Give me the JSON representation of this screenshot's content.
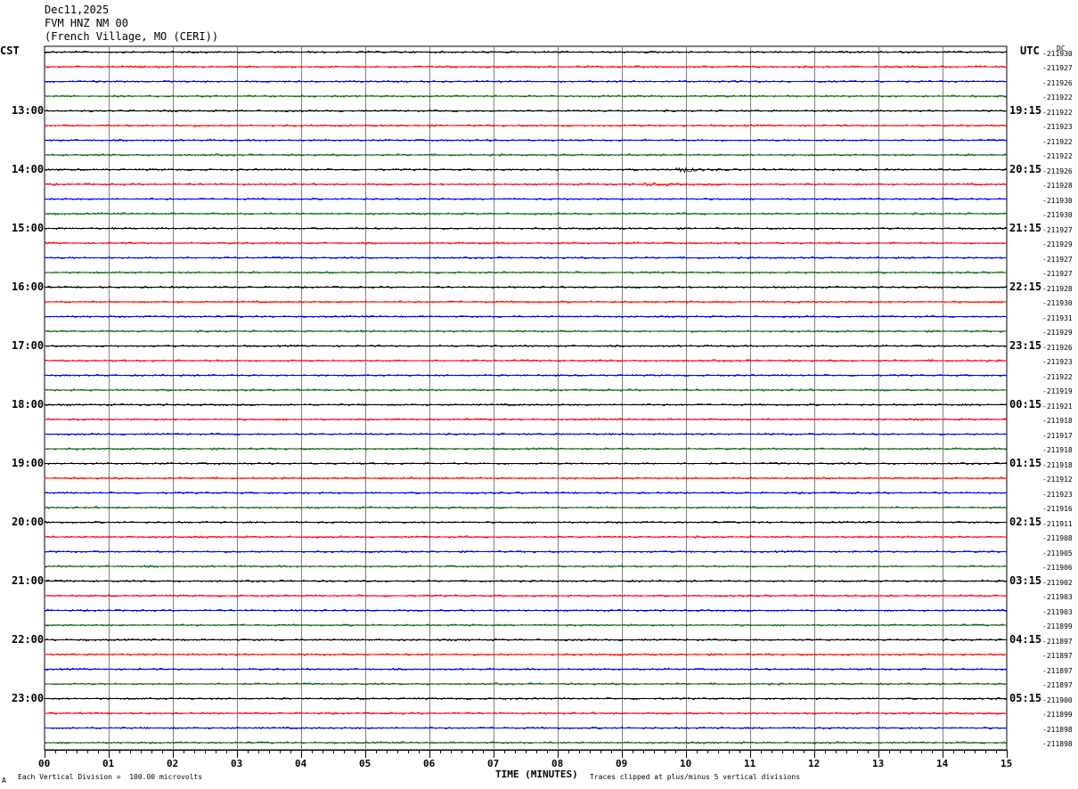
{
  "header": {
    "date": "Dec11,2025",
    "station": "FVM HNZ NM 00",
    "location": "(French Village, MO (CERI))"
  },
  "left_tz": "CST",
  "right_tz": "UTC",
  "dc_label": "DC",
  "footer": {
    "scale_note": "Each Vertical Division =  100.00 microvolts",
    "clip_note": "Traces clipped at plus/minus 5 vertical divisions",
    "corner_mark": "A"
  },
  "colors": {
    "trace_cycle": [
      "#000000",
      "#ff0000",
      "#0000ff",
      "#006400"
    ],
    "grid": "#808080"
  },
  "chart_data": {
    "type": "line",
    "title": "",
    "xlabel": "TIME (MINUTES)",
    "xlim": [
      0,
      15
    ],
    "x_ticks": [
      "00",
      "01",
      "02",
      "03",
      "04",
      "05",
      "06",
      "07",
      "08",
      "09",
      "10",
      "11",
      "12",
      "13",
      "14",
      "15"
    ],
    "left_hour_labels": [
      "13:00",
      "14:00",
      "15:00",
      "16:00",
      "17:00",
      "18:00",
      "19:00",
      "20:00",
      "21:00",
      "22:00",
      "23:00"
    ],
    "right_hour_labels": [
      "19:15",
      "20:15",
      "21:15",
      "22:15",
      "23:15",
      "00:15",
      "01:15",
      "02:15",
      "03:15",
      "04:15",
      "05:15"
    ],
    "dc_offsets": [
      "-211930",
      "-211927",
      "-211926",
      "-211922",
      "-211922",
      "-211923",
      "-211922",
      "-211922",
      "-211926",
      "-211928",
      "-211930",
      "-211930",
      "-211927",
      "-211929",
      "-211927",
      "-211927",
      "-211928",
      "-211930",
      "-211931",
      "-211929",
      "-211926",
      "-211923",
      "-211922",
      "-211919",
      "-211921",
      "-211918",
      "-211917",
      "-211918",
      "-211918",
      "-211912",
      "-211923",
      "-211916",
      "-211911",
      "-211908",
      "-211905",
      "-211906",
      "-211902",
      "-211903",
      "-211903",
      "-211899",
      "-211897",
      "-211897",
      "-211897",
      "-211897",
      "-211900",
      "-211899",
      "-211898",
      "-211898"
    ],
    "trace_count": 48,
    "trace_start_minutes": [
      0,
      0,
      0,
      0,
      0,
      0,
      0,
      0,
      0,
      0,
      0,
      0,
      0,
      0,
      0,
      0,
      0,
      0,
      0,
      0,
      0,
      0,
      0,
      0,
      0,
      0,
      0,
      0,
      0,
      0,
      0,
      0,
      0,
      0,
      0,
      0,
      0,
      0,
      0,
      0,
      0,
      0,
      0,
      0,
      0,
      0,
      0,
      0
    ],
    "events": [
      {
        "trace": 8,
        "minute": 9.9,
        "amplitude": 3
      },
      {
        "trace": 9,
        "minute": 9.4,
        "amplitude": 1.5
      }
    ]
  }
}
